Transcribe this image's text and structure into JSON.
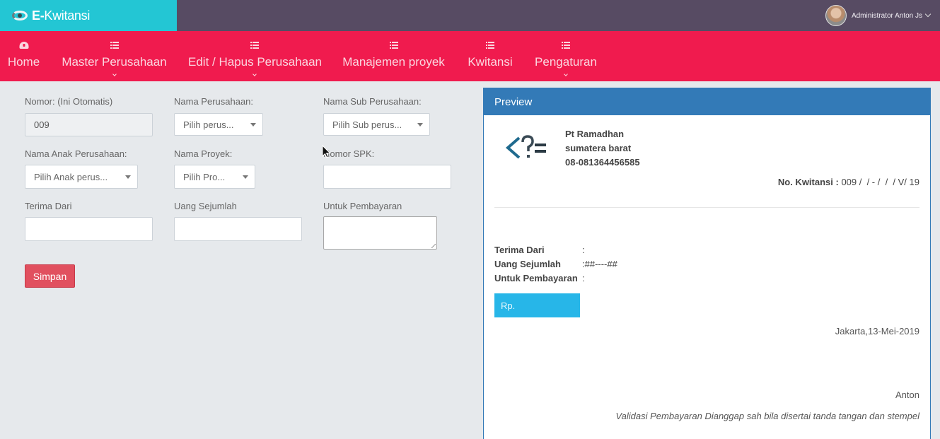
{
  "brand": {
    "prefix": "E-",
    "name": "Kwitansi"
  },
  "user": {
    "name": "Administrator Anton Js"
  },
  "nav": [
    {
      "label": "Home",
      "icon": "dashboard-icon"
    },
    {
      "label": "Master Perusahaan",
      "icon": "list-icon"
    },
    {
      "label": "Edit / Hapus Perusahaan",
      "icon": "list-icon"
    },
    {
      "label": "Manajemen proyek",
      "icon": "list-icon"
    },
    {
      "label": "Kwitansi",
      "icon": "list-icon"
    },
    {
      "label": "Pengaturan",
      "icon": "list-icon"
    }
  ],
  "form": {
    "nomor_label": "Nomor: (Ini Otomatis)",
    "nomor_value": "009",
    "perusahaan_label": "Nama Perusahaan:",
    "perusahaan_value": "Pilih perus...",
    "sub_label": "Nama Sub Perusahaan:",
    "sub_value": "Pilih Sub perus...",
    "anak_label": "Nama Anak Perusahaan:",
    "anak_value": "Pilih Anak perus...",
    "proyek_label": "Nama Proyek:",
    "proyek_value": "Pilih Pro...",
    "spk_label": "Nomor SPK:",
    "terima_label": "Terima Dari",
    "uang_label": "Uang Sejumlah",
    "untuk_label": "Untuk Pembayaran",
    "save_label": "Simpan"
  },
  "preview": {
    "title": "Preview",
    "company_name": "Pt Ramadhan",
    "company_region": "sumatera barat",
    "company_phone": "08-081364456585",
    "kw_label": "No. Kwitansi :",
    "kw_value": " 009 /  / - /  /  / V/ 19",
    "terima_label": "Terima Dari",
    "terima_value": ":",
    "uang_label": "Uang Sejumlah",
    "uang_value": ":##----##",
    "untuk_label": "Untuk Pembayaran",
    "untuk_value": ":",
    "rp_label": "Rp.",
    "date": "Jakarta,13-Mei-2019",
    "signer": "Anton",
    "note": "Validasi Pembayaran Dianggap sah bila disertai tanda tangan dan stempel"
  },
  "colors": {
    "brand_bg": "#23c6d4",
    "topbar_bg": "#574b63",
    "navbar_bg": "#f01b4e",
    "preview_accent": "#337ab7",
    "save_button": "#e1505f",
    "rp_box": "#27b6e8"
  }
}
